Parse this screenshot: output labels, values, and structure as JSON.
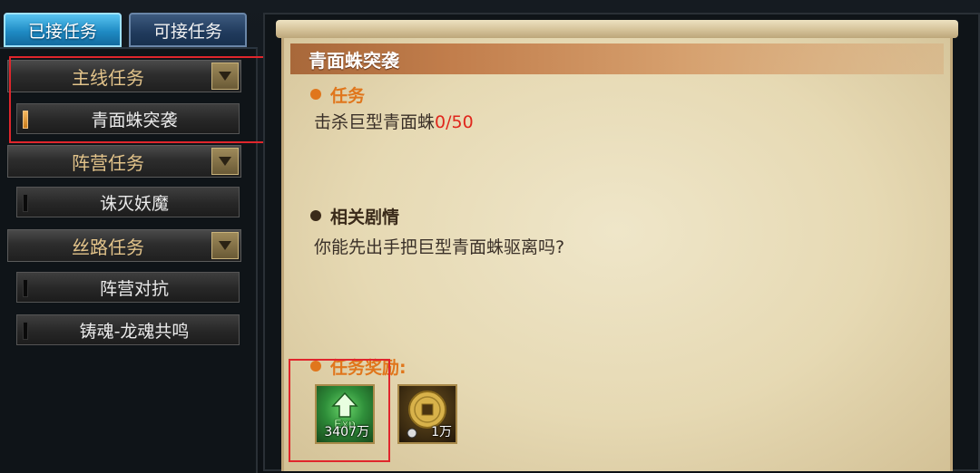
{
  "tabs": {
    "accepted": "已接任务",
    "available": "可接任务"
  },
  "categories": [
    {
      "label": "主线任务",
      "items": [
        "青面蛛突袭"
      ]
    },
    {
      "label": "阵营任务",
      "items": [
        "诛灭妖魔"
      ]
    },
    {
      "label": "丝路任务",
      "items": [
        "阵营对抗",
        "铸魂-龙魂共鸣"
      ]
    }
  ],
  "quest": {
    "title": "青面蛛突袭",
    "task_heading": "任务",
    "task_text": "击杀巨型青面蛛",
    "task_progress": "0/50",
    "story_heading": "相关剧情",
    "story_text": "你能先出手把巨型青面蛛驱离吗?",
    "reward_heading": "任务奖励:",
    "rewards": [
      {
        "icon": "exp-icon",
        "label": "Exp",
        "quantity": "3407万"
      },
      {
        "icon": "gold-coin-icon",
        "quantity": "1万"
      }
    ]
  },
  "colors": {
    "highlight_box": "#e0262c",
    "section_heading": "#e0761c",
    "progress": "#e0261c"
  }
}
